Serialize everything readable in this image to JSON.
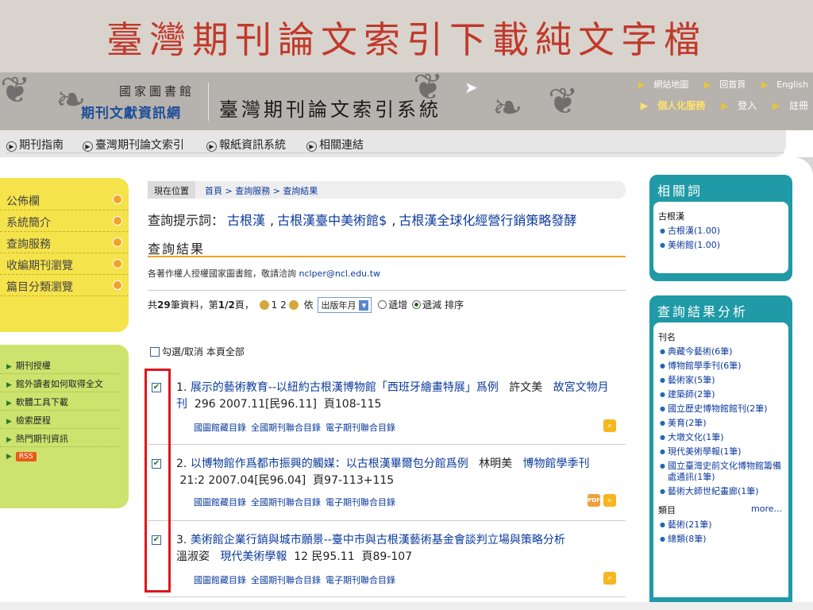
{
  "slide": {
    "title": "臺灣期刊論文索引下載純文字檔"
  },
  "header": {
    "logo_line1": "國家圖書館",
    "logo_line2": "期刊文獻資訊網",
    "system_title": "臺灣期刊論文索引系統",
    "links_row1": [
      "網站地圖",
      "回首頁",
      "English"
    ],
    "links_row2_bold": "個人化服務",
    "links_row2": [
      "登入",
      "註冊"
    ]
  },
  "nav": {
    "items": [
      "期刊指南",
      "臺灣期刊論文索引",
      "報紙資訊系統",
      "相關連結"
    ]
  },
  "sidebar": {
    "main_items": [
      "公佈欄",
      "系統簡介",
      "查詢服務",
      "收編期刊瀏覽",
      "篇目分類瀏覽"
    ],
    "sub_items": [
      "期刊授權",
      "館外讀者如何取得全文",
      "軟體工具下載",
      "檢索歷程",
      "熱門期刊資訊"
    ],
    "rss_label": "RSS"
  },
  "breadcrumb": {
    "here": "現在位置",
    "path": "首頁 > 查詢服務 > 查詢結果"
  },
  "hint": {
    "label": "查詢提示詞：",
    "terms": [
      "古根漢",
      "古根漢臺中美術館$",
      "古根漢全球化經營行銷策略發酵"
    ]
  },
  "results": {
    "title": "查詢結果",
    "authorization": "各著作權人授權國家圖書館，敬請洽詢",
    "email": "nclper@ncl.edu.tw",
    "count_prefix": "共",
    "total": "29",
    "count_mid": "筆資料，第",
    "page": "1/2",
    "count_suffix": "頁，",
    "page_numbers": [
      "1",
      "2"
    ],
    "sort_by": "依",
    "sort_field": "出版年月",
    "order_asc": "遞增",
    "order_desc": "遞減",
    "sort_suffix": "排序",
    "select_all": "勾選/取消 本頁全部",
    "holdings_links": [
      "國圖館藏目錄",
      "全國期刊聯合目錄",
      "電子期刊聯合目錄"
    ],
    "items": [
      {
        "num": "1.",
        "title": "展示的藝術教育--以紐約古根漢博物館「西班牙繪畫特展」爲例",
        "author": "許文美",
        "journal": "故宮文物月刊",
        "vol": "296 2007.11[民96.11]",
        "pages": "頁108-115"
      },
      {
        "num": "2.",
        "title": "以博物館作爲都市振興的觸媒：以古根漢畢爾包分館爲例",
        "author": "林明美",
        "journal": "博物館學季刊",
        "vol": "21:2 2007.04[民96.04]",
        "pages": "頁97-113+115"
      },
      {
        "num": "3.",
        "title": "美術館企業行銷與城市願景--臺中市與古根漢藝術基金會談判立場與策略分析",
        "author": "溫淑姿",
        "journal": "現代美術學報",
        "vol": "12 民95.11",
        "pages": "頁89-107"
      }
    ]
  },
  "related": {
    "title": "相關詞",
    "group": "古根漢",
    "items": [
      "古根漢(1.00)",
      "美術館(1.00)"
    ]
  },
  "analysis": {
    "title": "查詢結果分析",
    "journal_label": "刊名",
    "journals": [
      "典藏今藝術(6筆)",
      "博物館學季刊(6筆)",
      "藝術家(5筆)",
      "建築師(2筆)",
      "國立歷史博物館館刊(2筆)",
      "美育(2筆)",
      "大墩文化(1筆)",
      "現代美術學報(1筆)",
      "國立臺灣史前文化博物館籌備處通訊(1筆)",
      "藝術大師世紀畫廊(1筆)"
    ],
    "category_label": "類目",
    "more": "more...",
    "categories": [
      "藝術(21筆)",
      "總類(8筆)"
    ]
  }
}
